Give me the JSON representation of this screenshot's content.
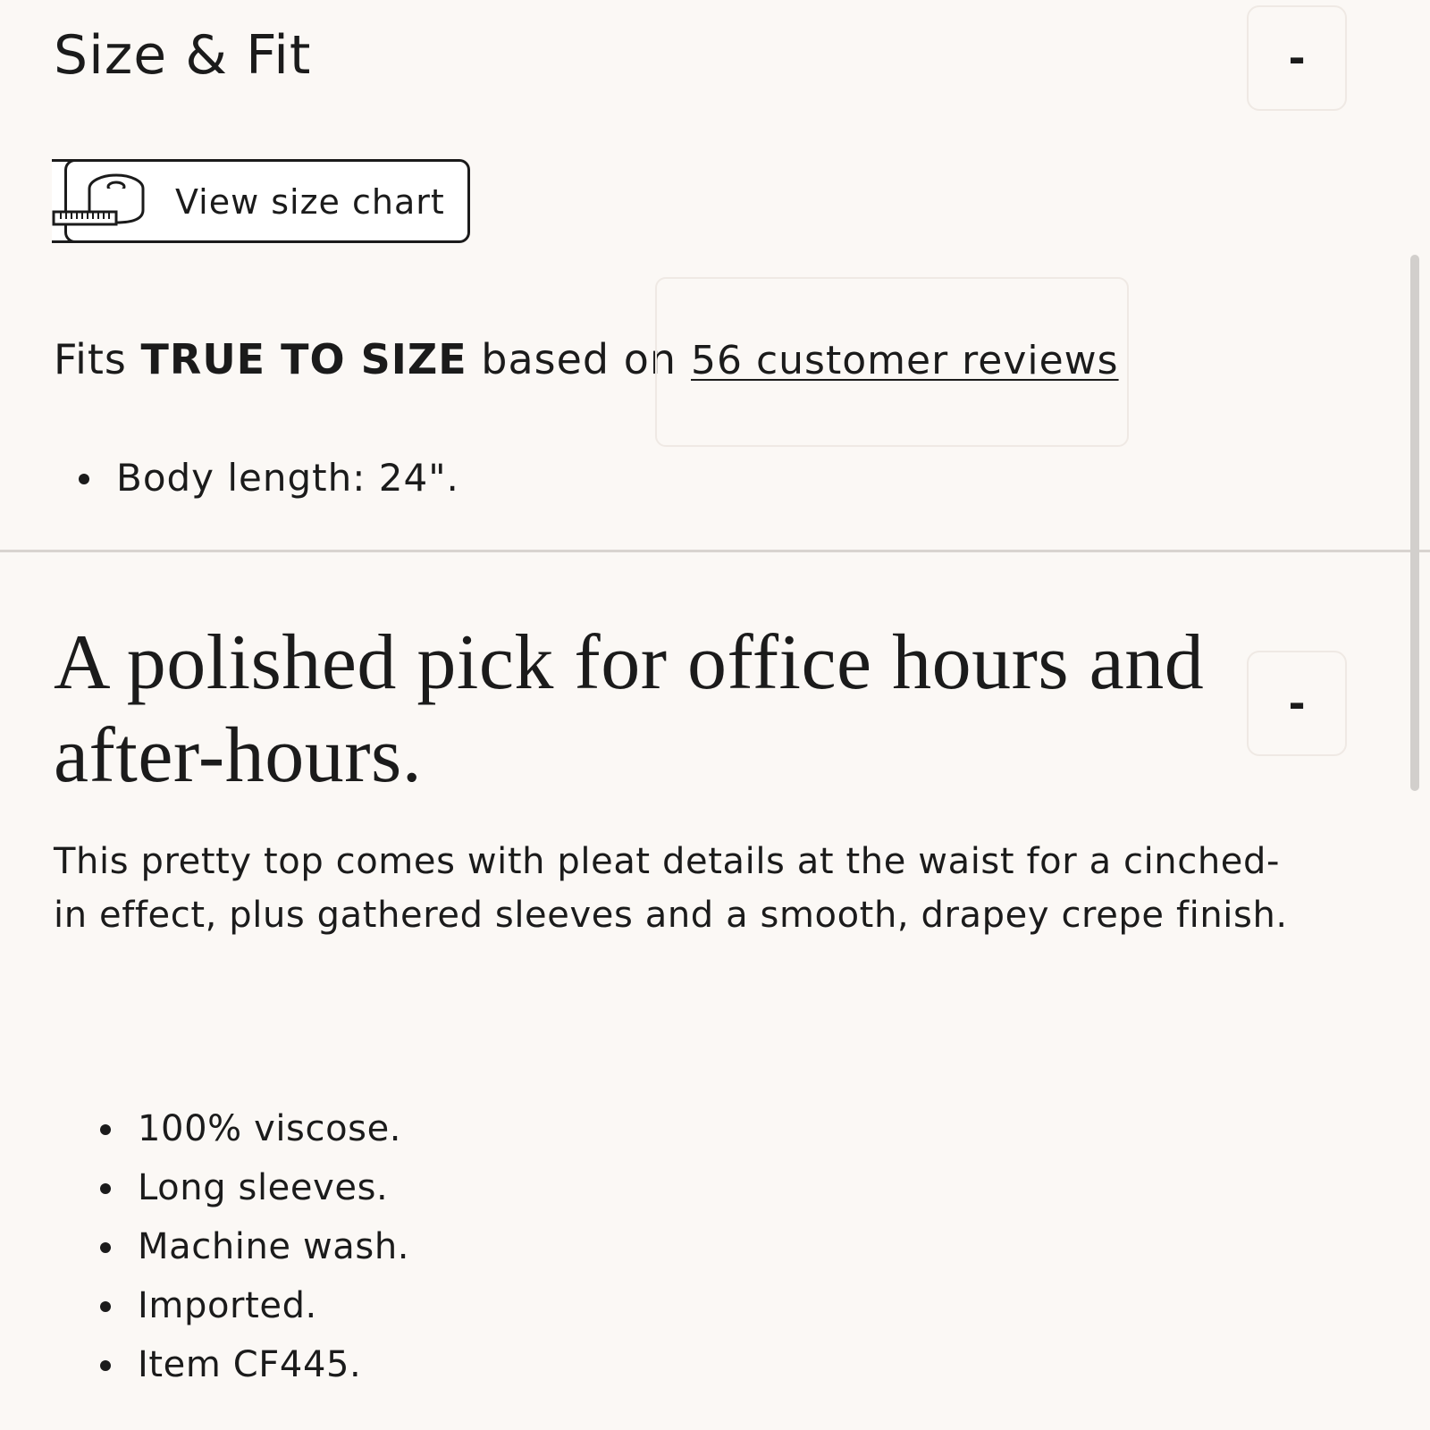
{
  "size_fit": {
    "title": "Size & Fit",
    "collapse_symbol": "-",
    "size_chart_button_label": "View size chart",
    "size_chart_icon": "measuring-tape-icon",
    "fit_prefix": "Fits ",
    "fit_value": "TRUE TO SIZE",
    "fit_suffix": " based on",
    "reviews_link": "56 customer reviews",
    "measurements": [
      "Body length: 24\"."
    ]
  },
  "description": {
    "headline": "A polished pick for office hours and after-hours.",
    "collapse_symbol": "-",
    "body": "This pretty top comes with pleat details at the waist for a cinched-in effect, plus gathered sleeves and a smooth, drapey crepe finish.",
    "details": [
      "100% viscose.",
      "Long sleeves.",
      "Machine wash.",
      "Imported.",
      "Item CF445."
    ]
  },
  "colors": {
    "background": "#fbf8f5",
    "text": "#1b1b1b",
    "border_light": "#efe9e4",
    "divider": "#d8d3cf"
  }
}
